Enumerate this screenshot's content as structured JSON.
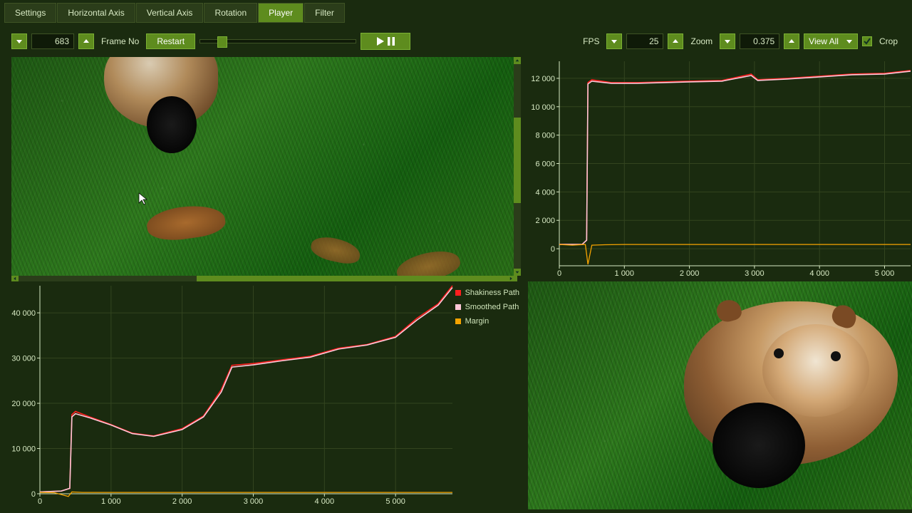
{
  "tabs": [
    {
      "label": "Settings",
      "active": false
    },
    {
      "label": "Horizontal Axis",
      "active": false
    },
    {
      "label": "Vertical Axis",
      "active": false
    },
    {
      "label": "Rotation",
      "active": false
    },
    {
      "label": "Player",
      "active": true
    },
    {
      "label": "Filter",
      "active": false
    }
  ],
  "toolbar": {
    "frame_value": "683",
    "frame_label": "Frame No",
    "restart_label": "Restart",
    "fps_label": "FPS",
    "fps_value": "25",
    "zoom_label": "Zoom",
    "zoom_value": "0.375",
    "viewmode_selected": "View All",
    "crop_label": "Crop",
    "crop_checked": true
  },
  "chart_data": [
    {
      "id": "bottom-left",
      "type": "line",
      "xlabel": "",
      "ylabel": "",
      "xlim": [
        0,
        5800
      ],
      "ylim": [
        0,
        46000
      ],
      "xticks": [
        0,
        1000,
        2000,
        3000,
        4000,
        5000
      ],
      "yticks": [
        0,
        10000,
        20000,
        30000,
        40000
      ],
      "xtick_labels": [
        "0",
        "1 000",
        "2 000",
        "3 000",
        "4 000",
        "5 000"
      ],
      "ytick_labels": [
        "0",
        "10 000",
        "20 000",
        "30 000",
        "40 000"
      ],
      "legend": [
        {
          "name": "Shakiness Path",
          "color": "#ff1e1e"
        },
        {
          "name": "Smoothed Path",
          "color": "#ffc8d8"
        },
        {
          "name": "Margin",
          "color": "#f5a300"
        }
      ],
      "series": [
        {
          "name": "Shakiness Path",
          "color": "#ff1e1e",
          "x": [
            0,
            300,
            420,
            450,
            500,
            700,
            1000,
            1300,
            1600,
            2000,
            2300,
            2550,
            2700,
            3000,
            3400,
            3800,
            4200,
            4600,
            5000,
            5300,
            5600,
            5800
          ],
          "y": [
            400,
            600,
            1200,
            17500,
            18200,
            17000,
            15300,
            13400,
            12800,
            14400,
            17200,
            23000,
            28400,
            28800,
            29600,
            30400,
            32200,
            33000,
            34800,
            38800,
            42000,
            46000
          ]
        },
        {
          "name": "Smoothed Path",
          "color": "#ffc8d8",
          "x": [
            0,
            300,
            420,
            450,
            500,
            700,
            1000,
            1300,
            1600,
            2000,
            2300,
            2550,
            2700,
            3000,
            3400,
            3800,
            4200,
            4600,
            5000,
            5300,
            5600,
            5800
          ],
          "y": [
            400,
            600,
            1200,
            17000,
            17700,
            16800,
            15200,
            13300,
            12700,
            14200,
            17000,
            22500,
            28000,
            28500,
            29400,
            30200,
            32000,
            32900,
            34600,
            38400,
            41700,
            45600
          ]
        },
        {
          "name": "Margin",
          "color": "#f5a300",
          "x": [
            0,
            200,
            400,
            450,
            600,
            1000,
            2000,
            3000,
            4000,
            5000,
            5800
          ],
          "y": [
            300,
            250,
            -600,
            400,
            300,
            300,
            300,
            300,
            300,
            300,
            300
          ]
        }
      ]
    },
    {
      "id": "top-right",
      "type": "line",
      "xlabel": "",
      "ylabel": "",
      "xlim": [
        0,
        5400
      ],
      "ylim": [
        -1200,
        13200
      ],
      "xticks": [
        0,
        1000,
        2000,
        3000,
        4000,
        5000
      ],
      "yticks": [
        0,
        2000,
        4000,
        6000,
        8000,
        10000,
        12000
      ],
      "xtick_labels": [
        "0",
        "1 000",
        "2 000",
        "3 000",
        "4 000",
        "5 000"
      ],
      "ytick_labels": [
        "0",
        "2 000",
        "4 000",
        "6 000",
        "8 000",
        "10 000",
        "12 000"
      ],
      "series": [
        {
          "name": "Shakiness Path",
          "color": "#ff1e1e",
          "x": [
            0,
            350,
            420,
            440,
            500,
            800,
            1200,
            1600,
            2000,
            2500,
            2950,
            3050,
            3500,
            4000,
            4500,
            5000,
            5400
          ],
          "y": [
            300,
            300,
            600,
            11700,
            11900,
            11700,
            11700,
            11750,
            11800,
            11850,
            12300,
            11900,
            12000,
            12150,
            12300,
            12350,
            12550
          ]
        },
        {
          "name": "Smoothed Path",
          "color": "#ffc8d8",
          "x": [
            0,
            350,
            420,
            440,
            500,
            800,
            1200,
            1600,
            2000,
            2500,
            2950,
            3050,
            3500,
            4000,
            4500,
            5000,
            5400
          ],
          "y": [
            300,
            300,
            600,
            11600,
            11800,
            11650,
            11650,
            11700,
            11750,
            11800,
            12200,
            11850,
            11950,
            12100,
            12250,
            12300,
            12500
          ]
        },
        {
          "name": "Margin",
          "color": "#f5a300",
          "x": [
            0,
            200,
            400,
            440,
            500,
            700,
            1000,
            2000,
            3000,
            4000,
            5000,
            5400
          ],
          "y": [
            300,
            250,
            300,
            -1100,
            250,
            280,
            300,
            300,
            300,
            300,
            300,
            300
          ]
        }
      ]
    }
  ]
}
